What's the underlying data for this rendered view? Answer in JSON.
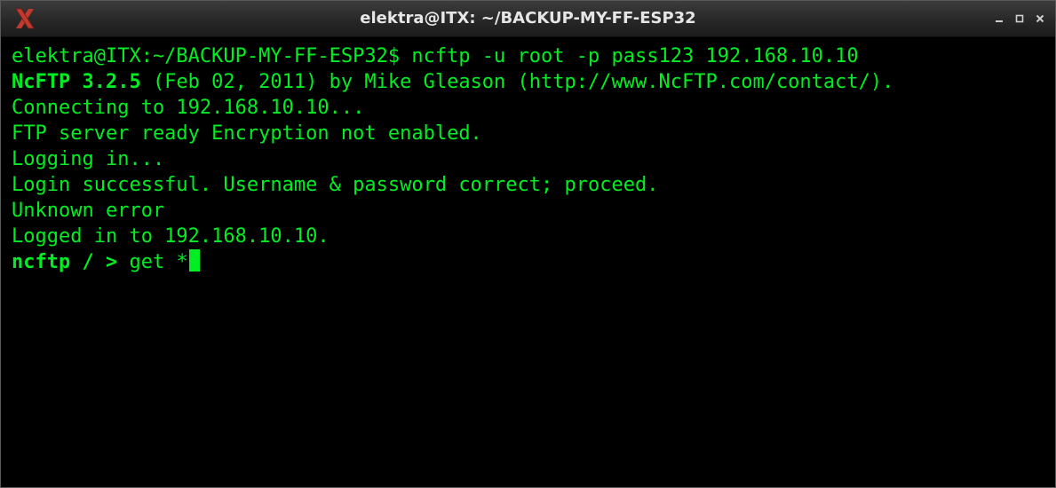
{
  "window": {
    "title": "elektra@ITX: ~/BACKUP-MY-FF-ESP32",
    "app_icon": "x-window-icon",
    "controls": [
      "minimize-icon",
      "maximize-icon",
      "close-icon"
    ]
  },
  "colors": {
    "terminal_bg": "#000000",
    "terminal_fg": "#00ee22",
    "titlebar_bg": "#2a2a2a",
    "title_fg": "#e6e6e6"
  },
  "terminal": {
    "lines": [
      {
        "prefix": "",
        "text": "elektra@ITX:~/BACKUP-MY-FF-ESP32$ ncftp -u root -p pass123 192.168.10.10"
      },
      {
        "prefix": "NcFTP 3.2.5",
        "text": " (Feb 02, 2011) by Mike Gleason (http://www.NcFTP.com/contact/)."
      },
      {
        "prefix": "",
        "text": "Connecting to 192.168.10.10..."
      },
      {
        "prefix": "",
        "text": "FTP server ready Encryption not enabled."
      },
      {
        "prefix": "",
        "text": "Logging in..."
      },
      {
        "prefix": "",
        "text": "Login successful. Username & password correct; proceed."
      },
      {
        "prefix": "",
        "text": "Unknown error"
      },
      {
        "prefix": "",
        "text": "Logged in to 192.168.10.10."
      }
    ],
    "prompt": {
      "label": "ncftp / >",
      "command": " get *"
    }
  }
}
